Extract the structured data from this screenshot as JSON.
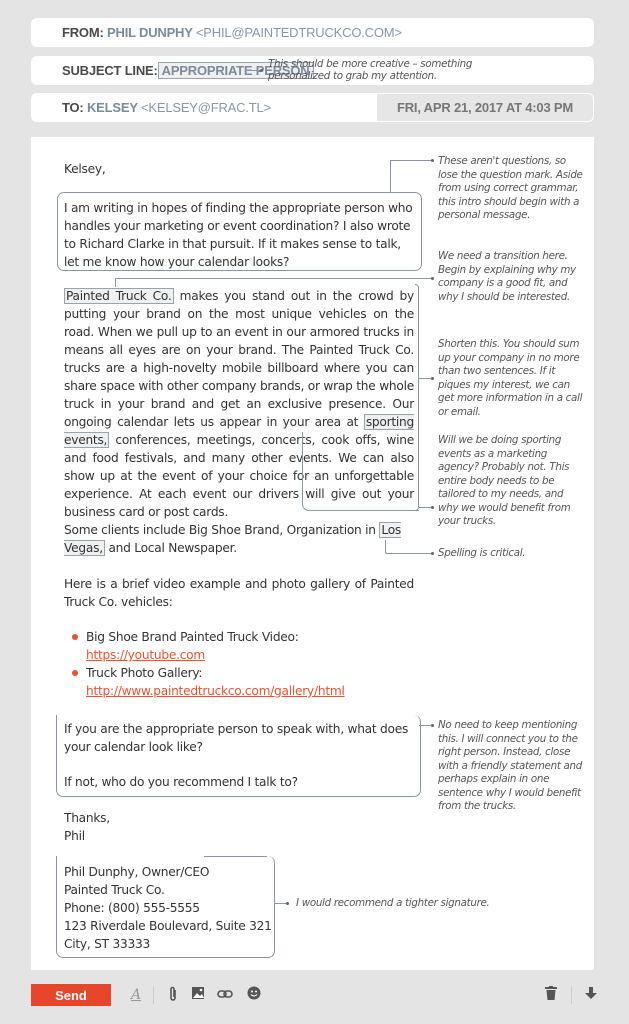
{
  "header": {
    "from_label": "FROM:",
    "from_name": "PHIL DUNPHY",
    "from_email": "<PHIL@PAINTEDTRUCKCO.COM>",
    "subject_label": "SUBJECT LINE:",
    "subject_value": "APPROPRIATE PERSON",
    "subject_note": "This should be more creative – something personalized to grab my attention.",
    "to_label": "TO:",
    "to_name": "KELSEY",
    "to_email": "<KELSEY@FRAC.TL>",
    "date": "FRI, APR 21, 2017 AT 4:03 PM"
  },
  "email": {
    "greeting": "Kelsey,",
    "intro": "I am writing in hopes of finding the appropriate person who handles your marketing or event coordination? I also wrote to Richard Clarke in that pursuit. If it makes sense to talk, let me know how your calendar looks?",
    "body_highlight_1": "Painted Truck Co.",
    "body_part_1": " makes you stand out in the crowd by putting your brand on the most unique vehicles on the road. When we pull up to an event in our armored trucks in means all eyes are on your brand. The Painted Truck Co. trucks are a high-novelty mobile billboard where you can share space with other company brands, or wrap the whole truck in your brand and get an exclusive presence. Our ongoing calendar lets us appear in your area at ",
    "body_highlight_2": "sporting events,",
    "body_part_2": " conferences, meetings, concerts, cook offs, wine and food festivals, and many other events. We can also show up at the event of your choice for an unforgettable experience. At each event our drivers will give out your business card or post cards.",
    "clients_part_1": "Some clients include Big Shoe Brand, Organization in ",
    "clients_highlight": "Los Vegas,",
    "clients_part_2": " and Local Newspaper.",
    "video_intro": "Here is a brief video example and photo gallery of Painted Truck Co. vehicles:",
    "links": [
      {
        "label": "Big Shoe Brand Painted Truck Video:",
        "url": "https://youtube.com"
      },
      {
        "label": "Truck Photo Gallery:",
        "url": "http://www.paintedtruckco.com/gallery/html"
      }
    ],
    "closing_question": "If you are the appropriate person to speak with, what does your calendar look like?",
    "closing_question_2": "If not, who do you recommend I talk to?",
    "signoff": "Thanks,",
    "signoff_name": "Phil",
    "signature": [
      "Phil Dunphy, Owner/CEO",
      "Painted Truck Co.",
      "Phone: (800) 555-5555",
      "123 Riverdale Boulevard, Suite 321",
      "City, ST 33333"
    ]
  },
  "notes": {
    "intro": "These aren't questions, so lose the question mark. Aside from using correct grammar, this intro should begin with a personal message.",
    "transition": "We need a transition here. Begin by explaining why my company is a good fit, and why I should be interested.",
    "shorten": "Shorten this. You should sum up your company in no more than two sentences. If it piques my interest, we can get more information in a call or email.",
    "sporting": "Will we be doing sporting events as a marketing agency? Probably not. This entire body needs to be tailored to my needs, and why we would benefit from your trucks.",
    "spelling": "Spelling is critical.",
    "closing": "No need to keep mentioning this. I will connect you to the right person. Instead, close with a friendly statement and perhaps explain in one sentence why I would benefit from the trucks.",
    "signature": "I would recommend a tighter signature."
  },
  "toolbar": {
    "send_label": "Send",
    "icons": [
      "format-text-icon",
      "attach-icon",
      "image-icon",
      "link-icon",
      "emoji-icon",
      "trash-icon",
      "more-options-icon"
    ]
  },
  "colors": {
    "accent": "#e8462a",
    "link": "#e8532f",
    "background": "#e4e4e4"
  }
}
